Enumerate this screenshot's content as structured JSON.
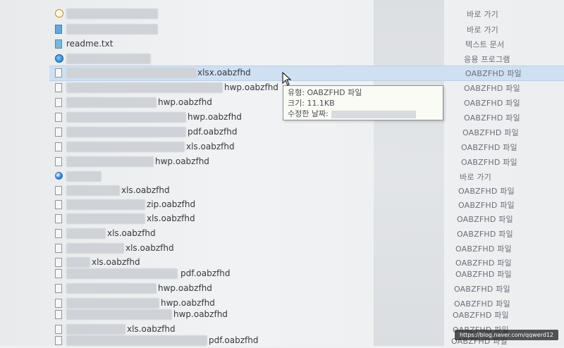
{
  "tooltip": {
    "type_label": "유형: OABZFHD 파일",
    "size_label": "크기: 11.1KB",
    "modified_label": "수정한 날짜:"
  },
  "rows": [
    {
      "icon": "clock-icon",
      "name": "",
      "type": "바로 가기"
    },
    {
      "icon": "folder-icon",
      "name": "",
      "type": "바로 가기"
    },
    {
      "icon": "text-file-icon",
      "name": "readme.txt",
      "type": "텍스트 문서"
    },
    {
      "icon": "ie-icon",
      "name": "",
      "type": "응용 프로그램"
    },
    {
      "icon": "file-icon",
      "name": "xlsx.oabzfhd",
      "type": "OABZFHD 파일"
    },
    {
      "icon": "file-icon",
      "name": "hwp.oabzfhd",
      "type": "OABZFHD 파일"
    },
    {
      "icon": "file-icon",
      "name": "hwp.oabzfhd",
      "type": "OABZFHD 파일"
    },
    {
      "icon": "file-icon",
      "name": "hwp.oabzfhd",
      "type": "OABZFHD 파일"
    },
    {
      "icon": "file-icon",
      "name": "pdf.oabzfhd",
      "type": "OABZFHD 파일"
    },
    {
      "icon": "file-icon",
      "name": "xls.oabzfhd",
      "type": "OABZFHD 파일"
    },
    {
      "icon": "file-icon",
      "name": "hwp.oabzfhd",
      "type": "OABZFHD 파일"
    },
    {
      "icon": "globe-icon",
      "name": "",
      "type": "바로 가기"
    },
    {
      "icon": "file-icon",
      "name": "xls.oabzfhd",
      "type": "OABZFHD 파일"
    },
    {
      "icon": "file-icon",
      "name": "zip.oabzfhd",
      "type": "OABZFHD 파일"
    },
    {
      "icon": "file-icon",
      "name": "xls.oabzfhd",
      "type": "OABZFHD 파일"
    },
    {
      "icon": "file-icon",
      "name": "xls.oabzfhd",
      "type": "OABZFHD 파일"
    },
    {
      "icon": "file-icon",
      "name": "xls.oabzfhd",
      "type": "OABZFHD 파일"
    },
    {
      "icon": "file-icon",
      "name": "xls.oabzfhd",
      "type": "OABZFHD 파일"
    },
    {
      "icon": "file-icon",
      "name": "pdf.oabzfhd",
      "type": "OABZFHD 파일"
    },
    {
      "icon": "file-icon",
      "name": "hwp.oabzfhd",
      "type": "OABZFHD 파일"
    },
    {
      "icon": "file-icon",
      "name": "hwp.oabzfhd",
      "type": "OABZFHD 파일"
    },
    {
      "icon": "file-icon",
      "name": "hwp.oabzfhd",
      "type": "OABZFHD 파일"
    },
    {
      "icon": "file-icon",
      "name": "xls.oabzfhd",
      "type": "OABZFHD 파일"
    },
    {
      "icon": "file-icon",
      "name": "pdf.oabzfhd",
      "type": "OABZFHD 파일"
    }
  ],
  "watermark": "https://blog.naver.com/qqwerd12",
  "colors": {
    "selection": "#cfe0f3",
    "background": "#eef0f2"
  }
}
